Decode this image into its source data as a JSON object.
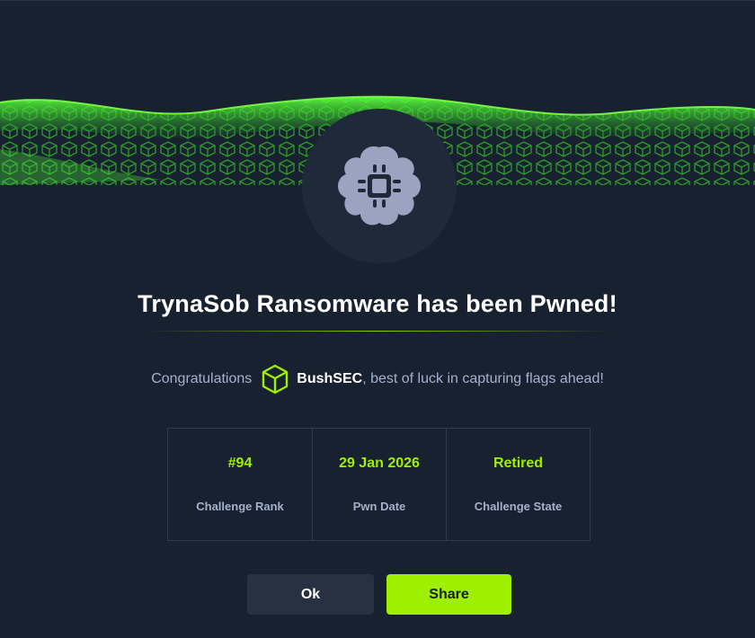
{
  "modal": {
    "title": "TrynaSob Ransomware has been Pwned!",
    "badge_icon": "brain-chip-icon",
    "accent_color": "#9fef00"
  },
  "congrats": {
    "prefix": "Congratulations",
    "user_icon": "cube-icon",
    "username": "BushSEC",
    "suffix": ", best of luck in capturing flags ahead!"
  },
  "stats": [
    {
      "value": "#94",
      "label": "Challenge Rank"
    },
    {
      "value": "29 Jan 2026",
      "label": "Pwn Date"
    },
    {
      "value": "Retired",
      "label": "Challenge State"
    }
  ],
  "buttons": {
    "ok": "Ok",
    "share": "Share"
  }
}
